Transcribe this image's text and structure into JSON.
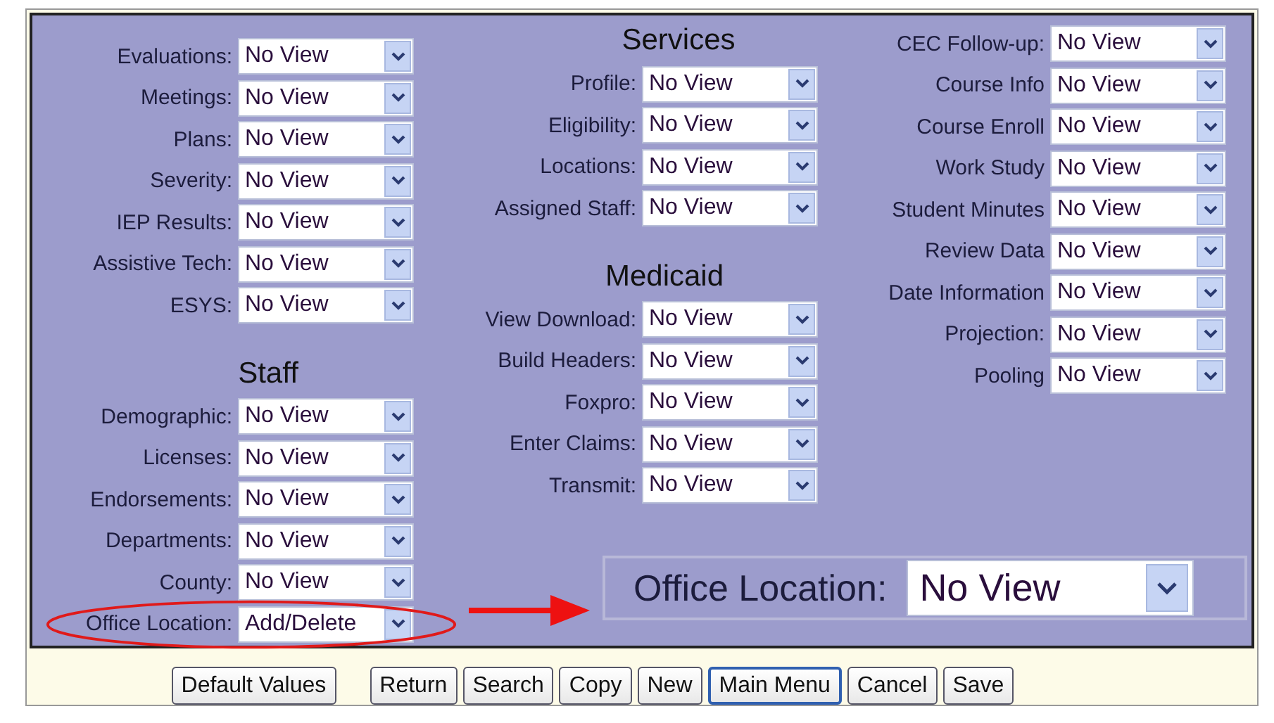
{
  "columns": [
    {
      "sections": [
        {
          "rows": [
            {
              "label": "Evaluations:",
              "value": "No View",
              "circled": false
            },
            {
              "label": "Meetings:",
              "value": "No View",
              "circled": false
            },
            {
              "label": "Plans:",
              "value": "No View",
              "circled": false
            },
            {
              "label": "Severity:",
              "value": "No View",
              "circled": false
            },
            {
              "label": "IEP Results:",
              "value": "No View",
              "circled": false
            },
            {
              "label": "Assistive Tech:",
              "value": "No View",
              "circled": false
            },
            {
              "label": "ESYS:",
              "value": "No View",
              "circled": false
            }
          ]
        },
        {
          "heading": "Staff",
          "rows": [
            {
              "label": "Demographic:",
              "value": "No View",
              "circled": false
            },
            {
              "label": "Licenses:",
              "value": "No View",
              "circled": false
            },
            {
              "label": "Endorsements:",
              "value": "No View",
              "circled": false
            },
            {
              "label": "Departments:",
              "value": "No View",
              "circled": false
            },
            {
              "label": "County:",
              "value": "No View",
              "circled": false
            },
            {
              "label": "Office Location:",
              "value": "Add/Delete",
              "circled": true
            }
          ]
        }
      ]
    },
    {
      "sections": [
        {
          "heading": "Services",
          "rows": [
            {
              "label": "Profile:",
              "value": "No View",
              "circled": false
            },
            {
              "label": "Eligibility:",
              "value": "No View",
              "circled": false
            },
            {
              "label": "Locations:",
              "value": "No View",
              "circled": false
            },
            {
              "label": "Assigned Staff:",
              "value": "No View",
              "circled": false
            }
          ]
        },
        {
          "heading": "Medicaid",
          "rows": [
            {
              "label": "View Download:",
              "value": "No View",
              "circled": false
            },
            {
              "label": "Build Headers:",
              "value": "No View",
              "circled": false
            },
            {
              "label": "Foxpro:",
              "value": "No View",
              "circled": false
            },
            {
              "label": "Enter Claims:",
              "value": "No View",
              "circled": false
            },
            {
              "label": "Transmit:",
              "value": "No View",
              "circled": false
            }
          ]
        }
      ]
    },
    {
      "sections": [
        {
          "rows": [
            {
              "label": "CEC Follow-up:",
              "value": "No View",
              "circled": false
            },
            {
              "label": "Course Info",
              "value": "No View",
              "circled": false
            },
            {
              "label": "Course Enroll",
              "value": "No View",
              "circled": false
            },
            {
              "label": "Work Study",
              "value": "No View",
              "circled": false
            },
            {
              "label": "Student Minutes",
              "value": "No View",
              "circled": false
            },
            {
              "label": "Review Data",
              "value": "No View",
              "circled": false
            },
            {
              "label": "Date Information",
              "value": "No View",
              "circled": false
            },
            {
              "label": "Projection:",
              "value": "No View",
              "circled": false
            },
            {
              "label": "Pooling",
              "value": "No View",
              "circled": false
            }
          ]
        }
      ]
    }
  ],
  "callout": {
    "label": "Office Location:",
    "value": "No View"
  },
  "button_groups": [
    [
      {
        "label": "Default Values",
        "focused": false
      }
    ],
    [
      {
        "label": "Return",
        "focused": false
      },
      {
        "label": "Search",
        "focused": false
      },
      {
        "label": "Copy",
        "focused": false
      },
      {
        "label": "New",
        "focused": false
      },
      {
        "label": "Main Menu",
        "focused": true
      },
      {
        "label": "Cancel",
        "focused": false
      },
      {
        "label": "Save",
        "focused": false
      }
    ]
  ]
}
